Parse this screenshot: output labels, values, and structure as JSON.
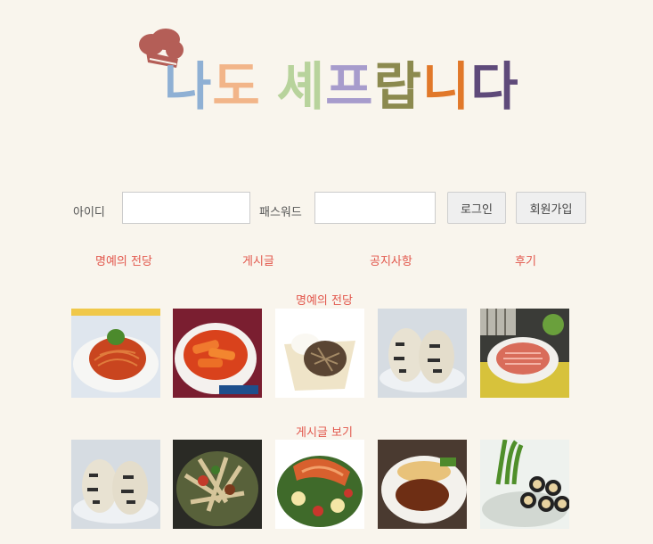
{
  "logo": {
    "title_chars": [
      "나",
      "도",
      " ",
      "셰",
      "프",
      "랍",
      "니",
      "다"
    ],
    "char_colors": [
      "#8fb0d4",
      "#f2b589",
      "",
      "#b8d39c",
      "#a79ccc",
      "#8c8a4f",
      "#e1782a",
      "#5f4a7a"
    ],
    "hat_color": "#b45e57"
  },
  "login": {
    "id_label": "아이디",
    "id_value": "",
    "pw_label": "패스워드",
    "pw_value": "",
    "login_button": "로그인",
    "signup_button": "회원가입"
  },
  "nav": {
    "items": [
      "명예의 전당",
      "게시글",
      "공지사항",
      "후기"
    ]
  },
  "sections": {
    "hall_of_fame_title": "명예의 전당",
    "posts_title": "게시글 보기"
  },
  "thumbs": {
    "row1": [
      "spaghetti-photo",
      "tteokbokki-photo",
      "rice-bowl-photo",
      "rice-ball-photo",
      "sushi-platter-photo"
    ],
    "row2": [
      "rice-ball-photo",
      "stirfry-photo",
      "salmon-salad-photo",
      "cutlet-photo",
      "kimbap-photo"
    ]
  },
  "colors": {
    "accent": "#e2574c",
    "background": "#f9f5ed"
  }
}
